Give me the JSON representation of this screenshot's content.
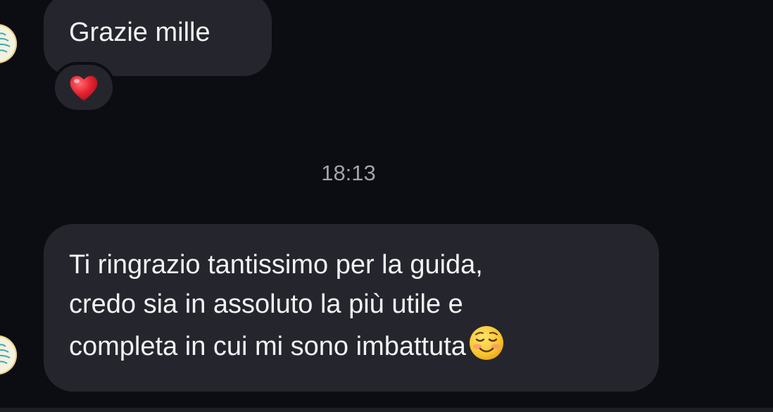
{
  "messages": [
    {
      "text": "Grazie mille",
      "reaction": "red-heart"
    },
    {
      "lines": [
        "Ti ringrazio tantissimo per la guida,",
        "credo sia in assoluto la più utile e",
        "completa in cui mi sono imbattuta"
      ],
      "trailing_emoji": "smiling-face-emoji"
    }
  ],
  "timestamp": "18:13",
  "colors": {
    "background": "#0c0d12",
    "bubble": "#25262d",
    "text": "#f2f2f4",
    "timestamp": "#a2a4ab",
    "heart": "#e6232f"
  }
}
